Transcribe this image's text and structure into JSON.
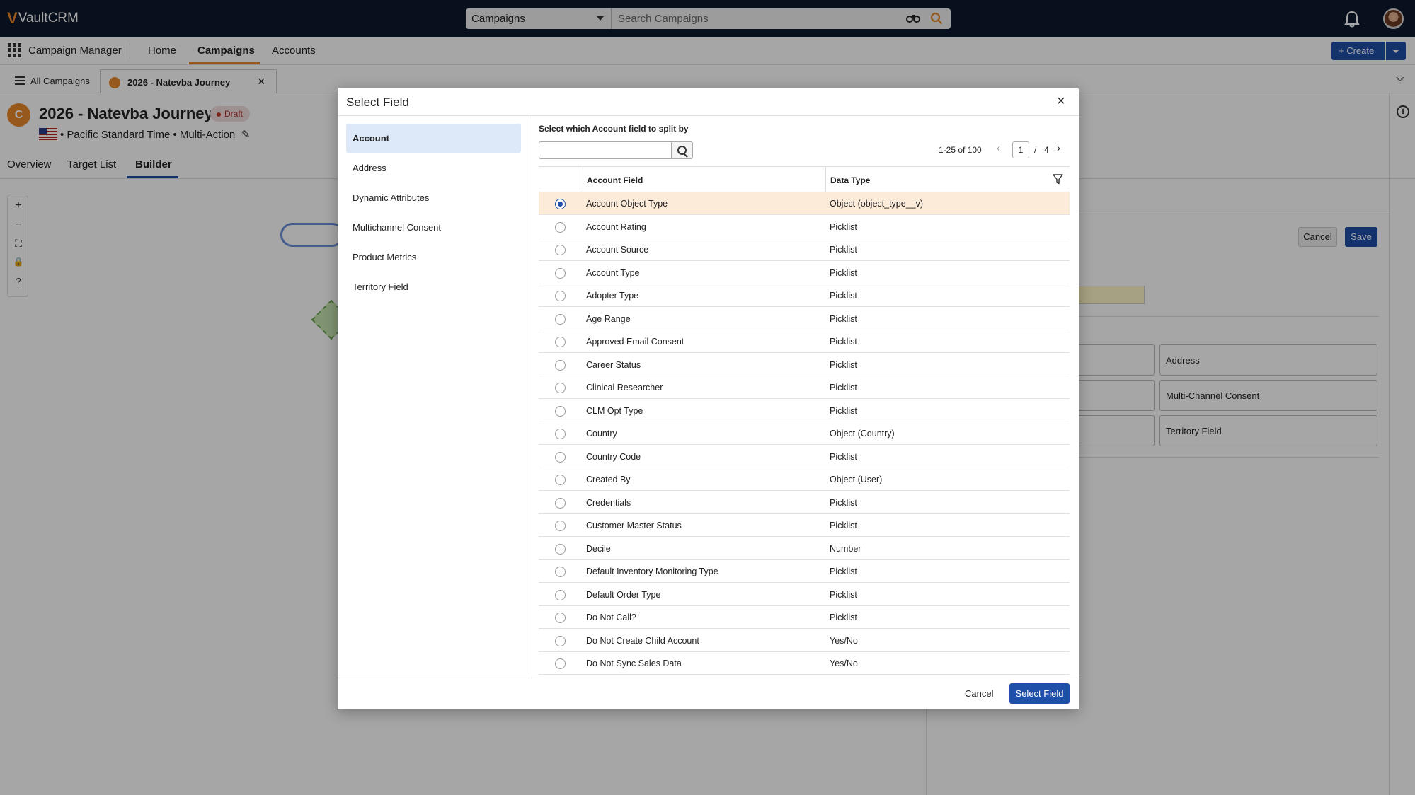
{
  "brand": {
    "accent": "#1f4fa8",
    "highlight": "#e8882a",
    "topbar": "#0d1a2e"
  },
  "header": {
    "logo_v": "V",
    "logo_text": "VaultCRM",
    "search_scope": "Campaigns",
    "search_placeholder": "Search Campaigns",
    "icons": [
      "binoculars-icon",
      "search-icon",
      "bell-icon",
      "avatar"
    ]
  },
  "nav": {
    "app_name": "Campaign Manager",
    "items": [
      "Home",
      "Campaigns",
      "Accounts"
    ],
    "active": "Campaigns",
    "create_label": "+ Create"
  },
  "tabs": {
    "all_label": "All Campaigns",
    "current_label": "2026 - Natevba Journey"
  },
  "record": {
    "icon_letter": "C",
    "title": "2026 - Natevba Journey",
    "status": "Draft",
    "subtitle": "• Pacific Standard Time • Multi-Action",
    "tabs": [
      "Overview",
      "Target List",
      "Builder"
    ],
    "active_tab": "Builder"
  },
  "canvas": {
    "tools": [
      "+",
      "−",
      "⛶",
      "🔒",
      "?"
    ]
  },
  "right_panel": {
    "cancel": "Cancel",
    "save": "Save",
    "cards": [
      "Address",
      "Multi-Channel Consent",
      "Territory Field"
    ]
  },
  "modal": {
    "title": "Select Field",
    "categories": [
      "Account",
      "Address",
      "Dynamic Attributes",
      "Multichannel Consent",
      "Product Metrics",
      "Territory Field"
    ],
    "active_category": "Account",
    "prompt": "Select which Account field to split by",
    "pager": {
      "range": "1-25 of 100",
      "page": "1",
      "slash": "/",
      "total": "4"
    },
    "columns": [
      "Account Field",
      "Data Type"
    ],
    "rows": [
      {
        "field": "Account Object Type",
        "type": "Object (object_type__v)",
        "selected": true
      },
      {
        "field": "Account Rating",
        "type": "Picklist"
      },
      {
        "field": "Account Source",
        "type": "Picklist"
      },
      {
        "field": "Account Type",
        "type": "Picklist"
      },
      {
        "field": "Adopter Type",
        "type": "Picklist"
      },
      {
        "field": "Age Range",
        "type": "Picklist"
      },
      {
        "field": "Approved Email Consent",
        "type": "Picklist"
      },
      {
        "field": "Career Status",
        "type": "Picklist"
      },
      {
        "field": "Clinical Researcher",
        "type": "Picklist"
      },
      {
        "field": "CLM Opt Type",
        "type": "Picklist"
      },
      {
        "field": "Country",
        "type": "Object (Country)"
      },
      {
        "field": "Country Code",
        "type": "Picklist"
      },
      {
        "field": "Created By",
        "type": "Object (User)"
      },
      {
        "field": "Credentials",
        "type": "Picklist"
      },
      {
        "field": "Customer Master Status",
        "type": "Picklist"
      },
      {
        "field": "Decile",
        "type": "Number"
      },
      {
        "field": "Default Inventory Monitoring Type",
        "type": "Picklist"
      },
      {
        "field": "Default Order Type",
        "type": "Picklist"
      },
      {
        "field": "Do Not Call?",
        "type": "Picklist"
      },
      {
        "field": "Do Not Create Child Account",
        "type": "Yes/No"
      },
      {
        "field": "Do Not Sync Sales Data",
        "type": "Yes/No"
      }
    ],
    "cancel": "Cancel",
    "select": "Select Field"
  }
}
